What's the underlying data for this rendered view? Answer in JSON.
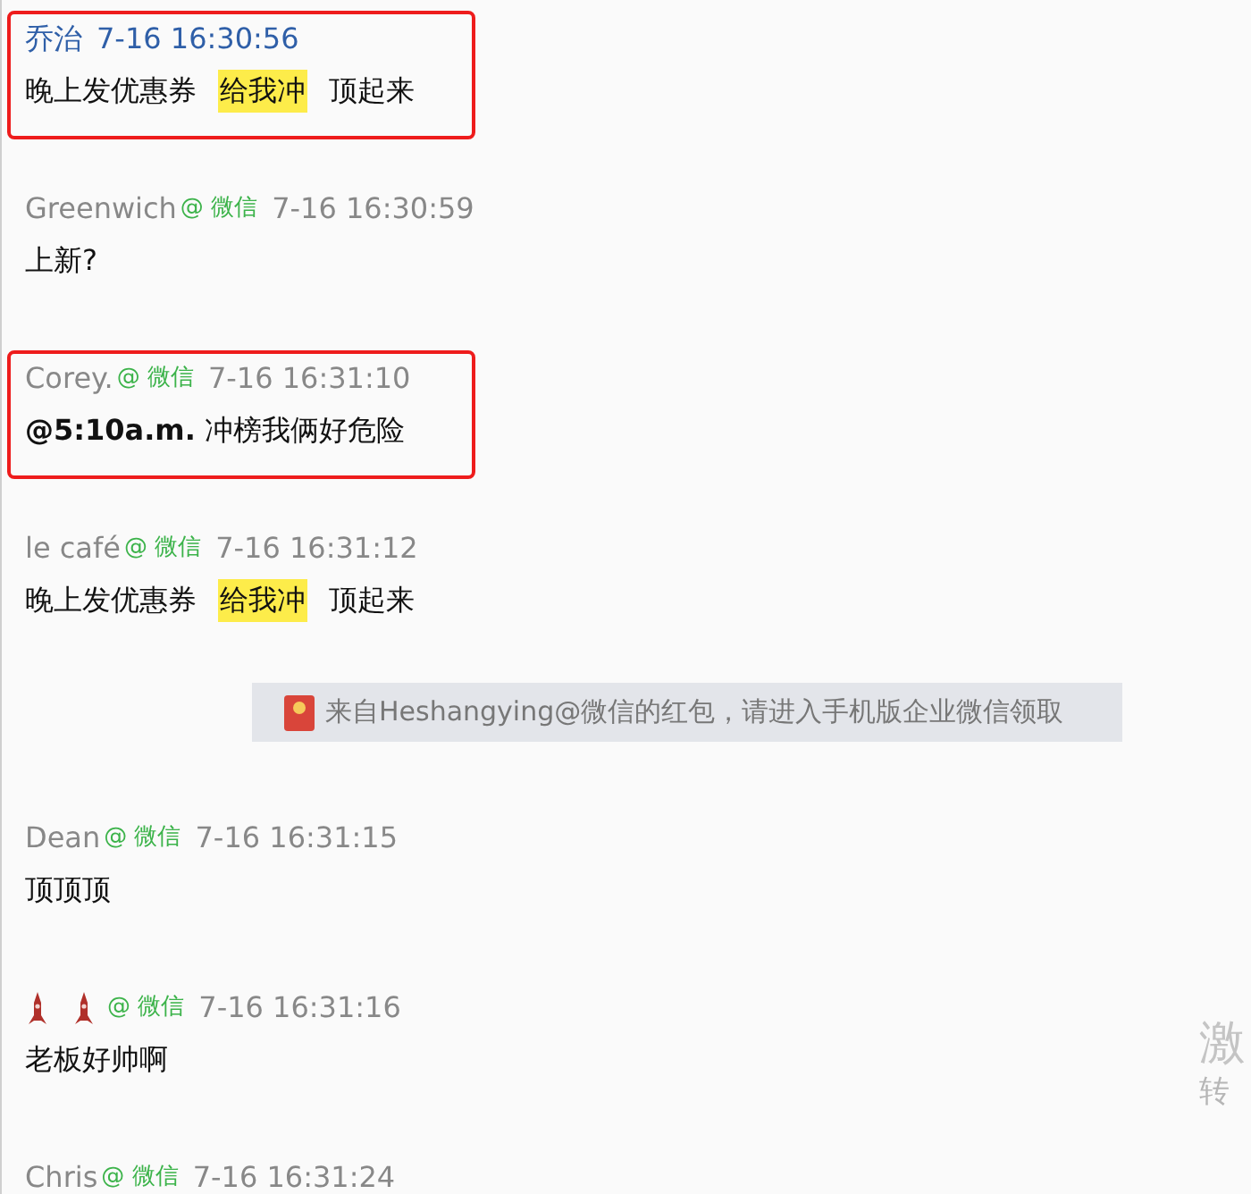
{
  "messages": [
    {
      "kind": "message",
      "sender": "乔治",
      "self": true,
      "time": "7-16 16:30:56",
      "highlighted": true,
      "parts": [
        {
          "text": "晚上发优惠券",
          "marked": false
        },
        {
          "text": "给我冲",
          "marked": true
        },
        {
          "text": "顶起来",
          "marked": false
        }
      ]
    },
    {
      "kind": "message",
      "sender": "Greenwich",
      "source": "@ 微信",
      "self": false,
      "time": "7-16 16:30:59",
      "highlighted": false,
      "parts": [
        {
          "text": "上新?",
          "marked": false
        }
      ]
    },
    {
      "kind": "message",
      "sender": "Corey.",
      "source": "@ 微信",
      "self": false,
      "time": "7-16 16:31:10",
      "highlighted": true,
      "parts": [
        {
          "text": "**@5:10a.m.** 冲榜我俩好危险",
          "marked": false
        }
      ]
    },
    {
      "kind": "message",
      "sender": "le café",
      "source": "@ 微信",
      "self": false,
      "time": "7-16 16:31:12",
      "highlighted": false,
      "parts": [
        {
          "text": "晚上发优惠券",
          "marked": false
        },
        {
          "text": "给我冲",
          "marked": true
        },
        {
          "text": "顶起来",
          "marked": false
        }
      ]
    },
    {
      "kind": "notice",
      "text": "来自Heshangying@微信的红包，请进入手机版企业微信领取"
    },
    {
      "kind": "message",
      "sender": "Dean",
      "source": "@ 微信",
      "self": false,
      "time": "7-16 16:31:15",
      "highlighted": false,
      "parts": [
        {
          "text": "顶顶顶",
          "marked": false
        }
      ]
    },
    {
      "kind": "message",
      "sender_as_icons": true,
      "source": "@ 微信",
      "self": false,
      "time": "7-16 16:31:16",
      "highlighted": false,
      "parts": [
        {
          "text": "老板好帅啊",
          "marked": false
        }
      ]
    },
    {
      "kind": "message",
      "sender": "Chris",
      "source": "@ 微信",
      "self": false,
      "time": "7-16 16:31:24",
      "highlighted": false
    }
  ],
  "overlay": {
    "line_1": "激",
    "line_2": "转"
  }
}
